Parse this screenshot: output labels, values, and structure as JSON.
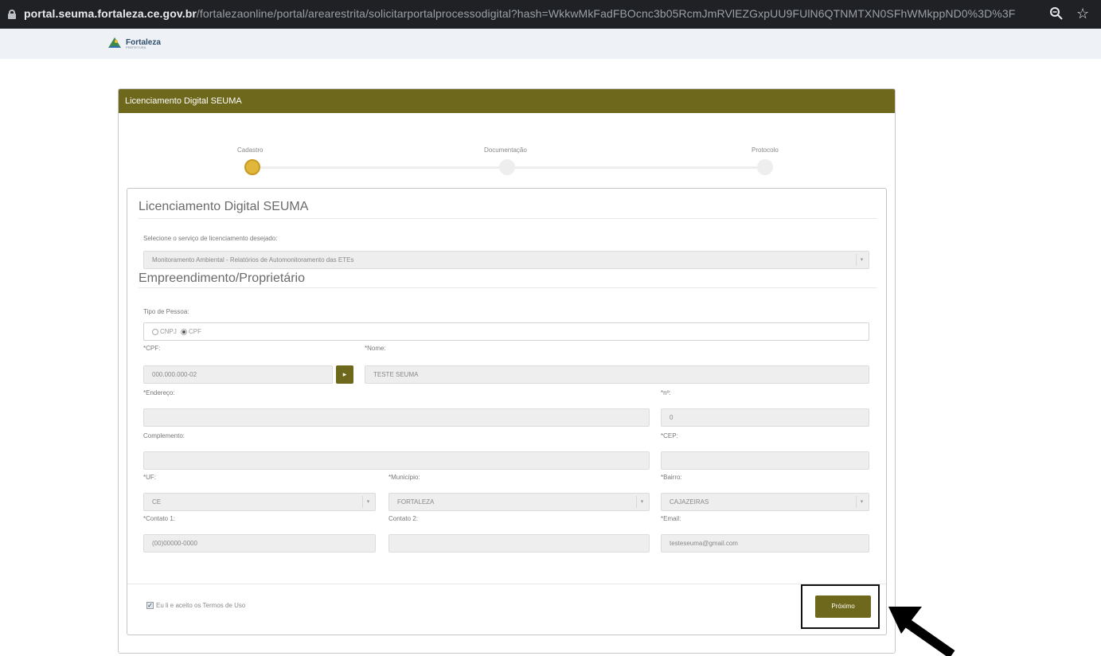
{
  "browser": {
    "url_host": "portal.seuma.fortaleza.ce.gov.br",
    "url_path": "/fortalezaonline/portal/arearestrita/solicitarportalprocessodigital?hash=WkkwMkFadFBOcnc3b05RcmJmRVlEZGxpUU9FUlN6QTNMTXN0SFhWMkppND0%3D%3F",
    "icons": [
      "lock-icon",
      "zoom-icon",
      "star-icon"
    ]
  },
  "site": {
    "logo_text": "Fortaleza",
    "logo_sub": "PREFEITURA"
  },
  "panel": {
    "title": "Licenciamento Digital SEUMA"
  },
  "steps": [
    {
      "label": "Cadastro",
      "active": true
    },
    {
      "label": "Documentação",
      "active": false
    },
    {
      "label": "Protocolo",
      "active": false
    }
  ],
  "form": {
    "section1_title": "Licenciamento Digital SEUMA",
    "service_label": "Selecione o serviço de licenciamento desejado:",
    "service_value": "Monitoramento Ambiental - Relatórios de Automonitoramento das ETEs",
    "section2_title": "Empreendimento/Proprietário",
    "tipo_pessoa_label": "Tipo de Pessoa:",
    "radio_cnpj": "CNPJ",
    "radio_cpf": "CPF",
    "selected_tipo": "CPF",
    "cpf_label": "*CPF:",
    "cpf_value": "000.000.000-02",
    "nome_label": "*Nome:",
    "nome_value": "TESTE SEUMA",
    "endereco_label": "*Endereço:",
    "endereco_value": "",
    "numero_label": "*nº:",
    "numero_value": "0",
    "complemento_label": "Complemento:",
    "complemento_value": "",
    "cep_label": "*CEP:",
    "cep_value": "",
    "uf_label": "*UF:",
    "uf_value": "CE",
    "municipio_label": "*Município:",
    "municipio_value": "FORTALEZA",
    "bairro_label": "*Bairro:",
    "bairro_value": "CAJAZEIRAS",
    "contato1_label": "*Contato 1:",
    "contato1_value": "(00)00000-0000",
    "contato2_label": "Contato 2:",
    "contato2_value": "",
    "email_label": "*Email:",
    "email_value": "testeseuma@gmail.com",
    "terms_label": "Eu li e aceito os Termos de Uso",
    "terms_checked": true,
    "next_label": "Próximo"
  },
  "colors": {
    "accent": "#6e681c",
    "step_active": "#e0b73a"
  }
}
